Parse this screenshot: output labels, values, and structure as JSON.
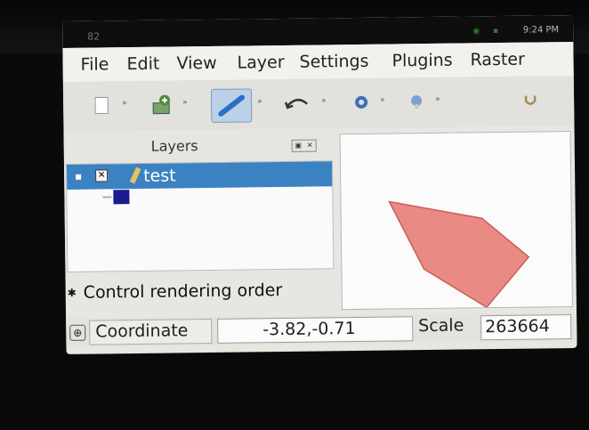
{
  "status": {
    "signal_left": "82",
    "time": "9:24 PM"
  },
  "menu": {
    "items": [
      "File",
      "Edit",
      "View",
      "Layer",
      "Settings",
      "Plugins",
      "Raster"
    ]
  },
  "toolbar": {
    "tools": [
      "new-project-icon",
      "add-layer-icon",
      "edit-pencil-icon",
      "undo-icon",
      "settings-icon",
      "identify-icon",
      "magnet-icon"
    ]
  },
  "layers_panel": {
    "title": "Layers",
    "layer_name": "test",
    "control_rendering_order": "Control rendering order"
  },
  "bottom": {
    "coordinate_label": "Coordinate",
    "coordinate_value": "-3.82,-0.71",
    "scale_label": "Scale",
    "scale_value": "263664"
  },
  "colors": {
    "selection": "#3b82c3",
    "polygon_fill": "#e98a84",
    "polygon_stroke": "#c95f59",
    "swatch": "#1c1c8f"
  }
}
